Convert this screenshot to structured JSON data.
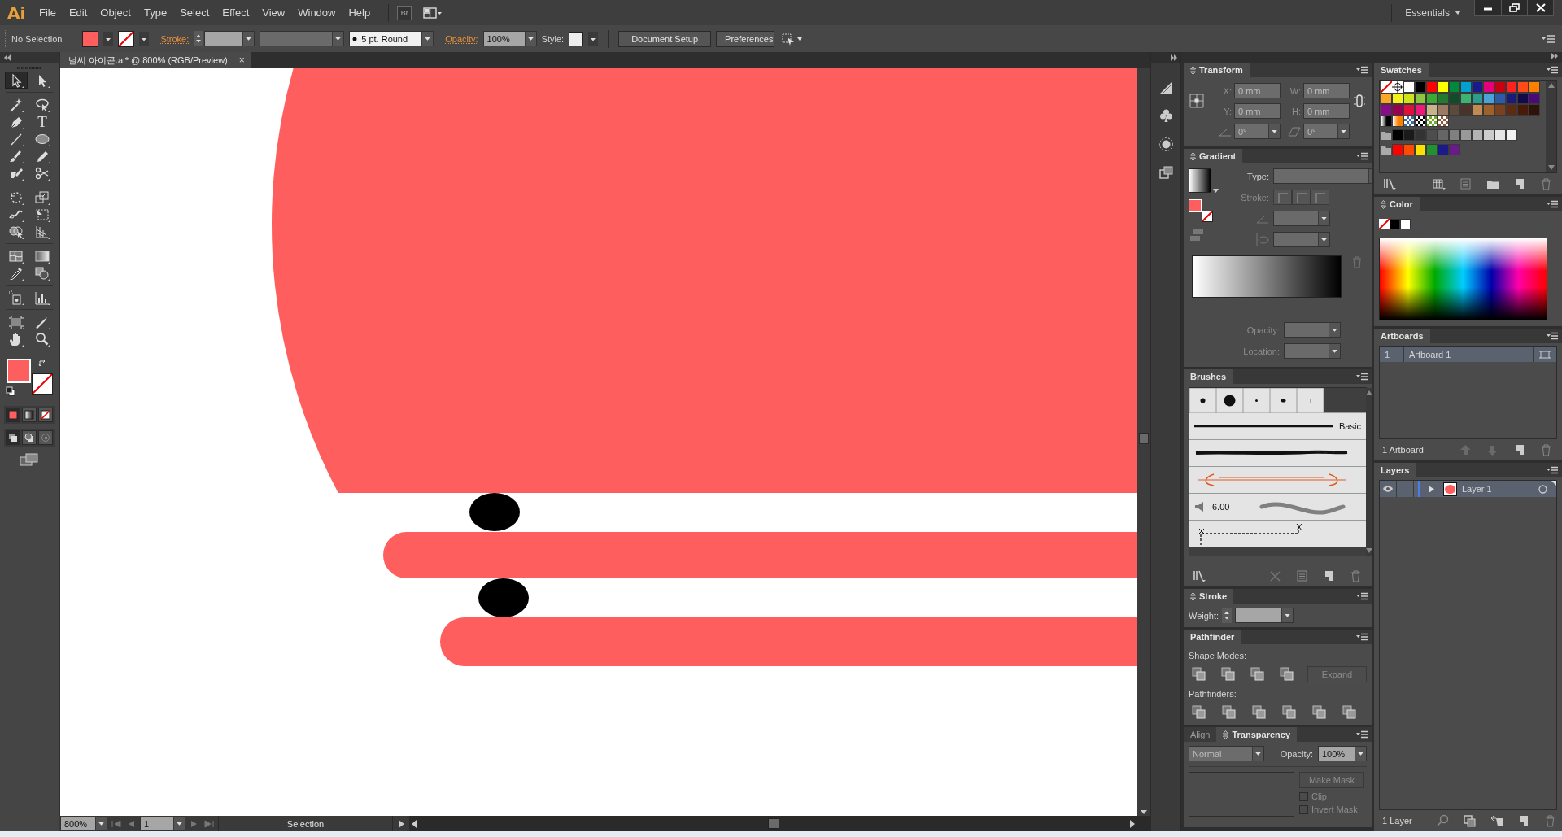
{
  "menu_bar": {
    "logo": "Ai",
    "items": [
      "File",
      "Edit",
      "Object",
      "Type",
      "Select",
      "Effect",
      "View",
      "Window",
      "Help"
    ],
    "bridge": "Br",
    "workspace": "Essentials"
  },
  "control_bar": {
    "selection": "No Selection",
    "fill_swatch": {
      "color": "#ff5e5e"
    },
    "stroke_swatch": {
      "kind": "none"
    },
    "stroke_label": "Stroke:",
    "brush": "5 pt. Round",
    "opacity_label": "Opacity:",
    "opacity": "100%",
    "style_label": "Style:",
    "buttons": [
      "Document Setup",
      "Preferences"
    ]
  },
  "toolbar": {
    "groups": [
      [
        {
          "kind": "selection",
          "selected": true
        },
        {
          "kind": "direct",
          "selected": false
        }
      ],
      [
        {
          "kind": "magic-wand",
          "selected": false
        },
        {
          "kind": "lasso",
          "selected": false
        },
        {
          "kind": "pen",
          "selected": false
        },
        {
          "kind": "type",
          "glyph": "T",
          "selected": false
        },
        {
          "kind": "line",
          "selected": false
        },
        {
          "kind": "ellipse",
          "selected": false
        },
        {
          "kind": "brush",
          "selected": false
        },
        {
          "kind": "pencil",
          "selected": false
        },
        {
          "kind": "eraser",
          "selected": false
        },
        {
          "kind": "scissors",
          "selected": false
        }
      ],
      [
        {
          "kind": "rotate",
          "selected": false
        },
        {
          "kind": "scale",
          "selected": false
        },
        {
          "kind": "warp",
          "selected": false
        },
        {
          "kind": "free-transform",
          "selected": false
        },
        {
          "kind": "shape-builder",
          "selected": false
        },
        {
          "kind": "perspective",
          "selected": false
        }
      ],
      [
        {
          "kind": "mesh",
          "selected": false
        },
        {
          "kind": "gradient",
          "selected": false
        },
        {
          "kind": "eyedropper",
          "selected": false
        },
        {
          "kind": "blend",
          "selected": false
        }
      ],
      [
        {
          "kind": "symbol-sprayer",
          "selected": false
        },
        {
          "kind": "graph",
          "selected": false
        }
      ],
      [
        {
          "kind": "artboard",
          "selected": false
        },
        {
          "kind": "slice",
          "selected": false
        },
        {
          "kind": "hand",
          "selected": false
        },
        {
          "kind": "zoom",
          "selected": false
        }
      ]
    ],
    "fill_swatch": {
      "color": "#ff5e5e"
    },
    "stroke_swatch": {
      "kind": "none"
    },
    "color_modes": [
      {
        "kind": "color",
        "selected": true
      },
      {
        "kind": "gradient",
        "selected": false
      },
      {
        "kind": "none",
        "selected": false
      }
    ],
    "draw_modes": [
      {
        "kind": "normal",
        "selected": true
      },
      {
        "kind": "behind",
        "selected": false
      },
      {
        "kind": "inside",
        "selected": false
      }
    ]
  },
  "document": {
    "tab": "날씨 아이콘.ai* @ 800% (RGB/Preview)",
    "close": "×",
    "artwork": [
      {
        "kind": "disc",
        "color": "#ff5e5e"
      },
      {
        "kind": "dot",
        "color": "#000000"
      },
      {
        "kind": "bar",
        "color": "#ff5e5e"
      },
      {
        "kind": "dot",
        "color": "#000000"
      },
      {
        "kind": "bar",
        "color": "#ff5e5e"
      }
    ]
  },
  "status_bar": {
    "zoom": "800%",
    "artboard": "1",
    "tool": "Selection"
  },
  "panels": {
    "transform": {
      "tabs": [
        {
          "label": "Transform",
          "selected": true,
          "options": true
        }
      ],
      "x_label": "X:",
      "x": "0 mm",
      "w_label": "W:",
      "w": "0 mm",
      "y_label": "Y:",
      "y": "0 mm",
      "h_label": "H:",
      "h": "0 mm",
      "angle": "0°",
      "shear": "0°"
    },
    "gradient": {
      "tabs": [
        {
          "label": "Gradient",
          "selected": true,
          "options": true
        }
      ],
      "fill_swatch": {
        "color": "#ff5e5e"
      },
      "stroke_swatch": {
        "kind": "none"
      },
      "type_label": "Type:",
      "stroke_label": "Stroke:",
      "opacity_label": "Opacity:",
      "location_label": "Location:"
    },
    "brushes": {
      "tabs": [
        {
          "label": "Brushes",
          "selected": true,
          "options": false
        }
      ],
      "items": [
        {
          "kind": "dabs"
        },
        {
          "kind": "basic",
          "label": "Basic"
        },
        {
          "kind": "charcoal"
        },
        {
          "kind": "arrow"
        },
        {
          "kind": "bristle",
          "label": "6.00"
        },
        {
          "kind": "pattern"
        }
      ]
    },
    "stroke": {
      "tabs": [
        {
          "label": "Stroke",
          "selected": true,
          "options": true
        }
      ],
      "weight_label": "Weight:"
    },
    "pathfinder": {
      "tabs": [
        {
          "label": "Pathfinder",
          "selected": true,
          "options": false
        }
      ],
      "shape_modes_label": "Shape Modes:",
      "expand": {
        "label": "Expand",
        "disabled": true
      },
      "pathfinders_label": "Pathfinders:"
    },
    "transparency": {
      "tabs": [
        {
          "label": "Align",
          "selected": false,
          "options": false
        },
        {
          "label": "Transparency",
          "selected": true,
          "options": true
        }
      ],
      "blend_mode": "Normal",
      "opacity_label": "Opacity:",
      "opacity": "100%",
      "make_mask": {
        "label": "Make Mask",
        "disabled": true
      },
      "checkboxes": [
        {
          "label": "Clip",
          "checked": false,
          "disabled": true
        },
        {
          "label": "Invert Mask",
          "checked": false,
          "disabled": true
        }
      ]
    },
    "swatches": {
      "tabs": [
        {
          "label": "Swatches",
          "selected": true,
          "options": false
        }
      ],
      "rows": [
        {
          "group": false,
          "swatches": [
            {
              "kind": "none"
            },
            {
              "kind": "registration"
            },
            {
              "kind": "color",
              "color": "#ffffff"
            },
            {
              "kind": "color",
              "color": "#000000"
            },
            {
              "kind": "color",
              "color": "#ff0000"
            },
            {
              "kind": "color",
              "color": "#ffff00"
            },
            {
              "kind": "color",
              "color": "#008b3a"
            },
            {
              "kind": "color",
              "color": "#00a0d0"
            },
            {
              "kind": "color",
              "color": "#1a1a8a"
            },
            {
              "kind": "color",
              "color": "#e6007e"
            },
            {
              "kind": "color",
              "color": "#c8000f"
            },
            {
              "kind": "color",
              "color": "#ff2020"
            },
            {
              "kind": "color",
              "color": "#ff4a1a"
            },
            {
              "kind": "color",
              "color": "#ff8000"
            }
          ]
        },
        {
          "group": false,
          "swatches": [
            {
              "kind": "color",
              "color": "#f9a825"
            },
            {
              "kind": "color",
              "color": "#f5f21c"
            },
            {
              "kind": "color",
              "color": "#cfe318"
            },
            {
              "kind": "color",
              "color": "#8cc63f"
            },
            {
              "kind": "color",
              "color": "#3aaa35"
            },
            {
              "kind": "color",
              "color": "#217a2e"
            },
            {
              "kind": "color",
              "color": "#0e4d26"
            },
            {
              "kind": "color",
              "color": "#3cb371"
            },
            {
              "kind": "color",
              "color": "#2a9d8f"
            },
            {
              "kind": "color",
              "color": "#4aa3d8"
            },
            {
              "kind": "color",
              "color": "#2e5aa8"
            },
            {
              "kind": "color",
              "color": "#1a1a7a"
            },
            {
              "kind": "color",
              "color": "#140a4a"
            },
            {
              "kind": "color",
              "color": "#4b0a7a"
            }
          ]
        },
        {
          "group": false,
          "swatches": [
            {
              "kind": "color",
              "color": "#8a0a8a"
            },
            {
              "kind": "color",
              "color": "#9a0050"
            },
            {
              "kind": "color",
              "color": "#e0103c"
            },
            {
              "kind": "color",
              "color": "#f0187a"
            },
            {
              "kind": "color",
              "color": "#c8b48a"
            },
            {
              "kind": "color",
              "color": "#9a7a60"
            },
            {
              "kind": "color",
              "color": "#5e4a3a"
            },
            {
              "kind": "color",
              "color": "#4a3228"
            },
            {
              "kind": "color",
              "color": "#c08a50"
            },
            {
              "kind": "color",
              "color": "#a0602a"
            },
            {
              "kind": "color",
              "color": "#7a4020"
            },
            {
              "kind": "color",
              "color": "#5e2a10"
            },
            {
              "kind": "color",
              "color": "#4a1a08"
            },
            {
              "kind": "color",
              "color": "#2e1408"
            }
          ]
        },
        {
          "group": false,
          "swatches": [
            {
              "kind": "gradient",
              "color": "#000000"
            },
            {
              "kind": "gradient",
              "color": "#ff8000"
            },
            {
              "kind": "pattern",
              "color": "#3a6ab0"
            },
            {
              "kind": "pattern",
              "color": "#000000"
            },
            {
              "kind": "pattern",
              "color": "#6ab020"
            },
            {
              "kind": "pattern",
              "color": "#8a5a40"
            }
          ]
        },
        {
          "group": true,
          "swatches": [
            {
              "kind": "color",
              "color": "#000000"
            },
            {
              "kind": "color",
              "color": "#1a1a1a"
            },
            {
              "kind": "color",
              "color": "#333333"
            },
            {
              "kind": "color",
              "color": "#4d4d4d"
            },
            {
              "kind": "color",
              "color": "#666666"
            },
            {
              "kind": "color",
              "color": "#808080"
            },
            {
              "kind": "color",
              "color": "#999999"
            },
            {
              "kind": "color",
              "color": "#b3b3b3"
            },
            {
              "kind": "color",
              "color": "#cccccc"
            },
            {
              "kind": "color",
              "color": "#e6e6e6"
            },
            {
              "kind": "color",
              "color": "#f2f2f2"
            }
          ]
        },
        {
          "group": true,
          "swatches": [
            {
              "kind": "color",
              "color": "#ff0000"
            },
            {
              "kind": "color",
              "color": "#ff4a00"
            },
            {
              "kind": "color",
              "color": "#ffe000"
            },
            {
              "kind": "color",
              "color": "#22922e"
            },
            {
              "kind": "color",
              "color": "#1a1a8a"
            },
            {
              "kind": "color",
              "color": "#6a1a8a"
            }
          ]
        }
      ]
    },
    "color": {
      "tabs": [
        {
          "label": "Color",
          "selected": true,
          "options": true
        }
      ],
      "quick": [
        {
          "kind": "none"
        },
        {
          "kind": "color",
          "color": "#000000"
        },
        {
          "kind": "color",
          "color": "#ffffff"
        }
      ]
    },
    "artboards": {
      "tabs": [
        {
          "label": "Artboards",
          "selected": true,
          "options": false
        }
      ],
      "items": [
        {
          "number": "1",
          "name": "Artboard 1",
          "selected": true
        }
      ],
      "count": "1 Artboard"
    },
    "layers": {
      "tabs": [
        {
          "label": "Layers",
          "selected": true,
          "options": false
        }
      ],
      "items": [
        {
          "name": "Layer 1",
          "visible": true,
          "selected": true,
          "color": "#4a7cf0",
          "thumbnail": {
            "color": "#ff5e5e"
          }
        }
      ],
      "count": "1 Layer"
    }
  }
}
